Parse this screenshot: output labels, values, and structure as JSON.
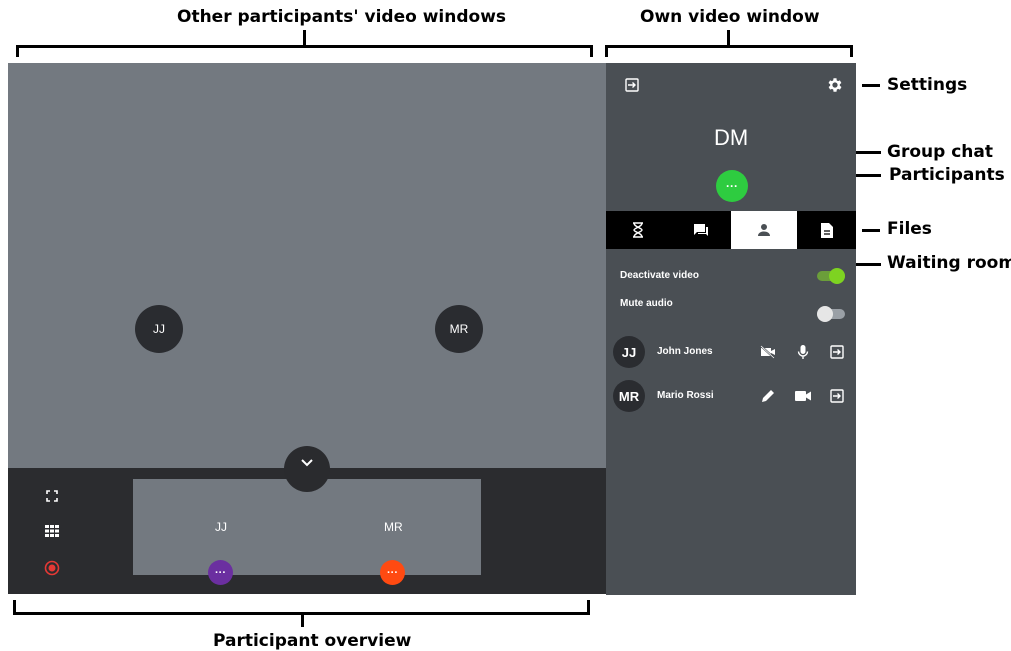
{
  "annotations": {
    "others_video": "Other participants' video windows",
    "own_video": "Own video window",
    "settings": "Settings",
    "group_chat": "Group chat",
    "participants": "Participants",
    "files": "Files",
    "waiting_room": "Waiting room",
    "overview": "Participant overview"
  },
  "video_area": {
    "participants": [
      {
        "initials": "JJ"
      },
      {
        "initials": "MR"
      }
    ]
  },
  "overview": {
    "thumbs": [
      {
        "initials": "JJ",
        "dot_color": "#6b2fa0",
        "dot_label": "···"
      },
      {
        "initials": "MR",
        "dot_color": "#ff4a11",
        "dot_label": "···"
      }
    ],
    "side_icons": [
      "fullscreen-icon",
      "grid-icon",
      "record-icon"
    ],
    "record_color": "#e53935"
  },
  "own_panel": {
    "initials": "DM",
    "status_dot_label": "···",
    "status_color": "#2ecc40",
    "tabs": [
      "waiting-room-icon",
      "group-chat-icon",
      "participants-icon",
      "files-icon"
    ],
    "active_tab": "participants-icon",
    "toggles": [
      {
        "label": "Deactivate video",
        "on": true
      },
      {
        "label": "Mute audio",
        "on": false
      }
    ],
    "participants": [
      {
        "initials": "JJ",
        "name": "John Jones",
        "icons": [
          "video-off-icon",
          "mic-icon",
          "exit-icon"
        ]
      },
      {
        "initials": "MR",
        "name": "Mario Rossi",
        "icons": [
          "pencil-icon",
          "video-icon",
          "exit-icon"
        ]
      }
    ]
  }
}
